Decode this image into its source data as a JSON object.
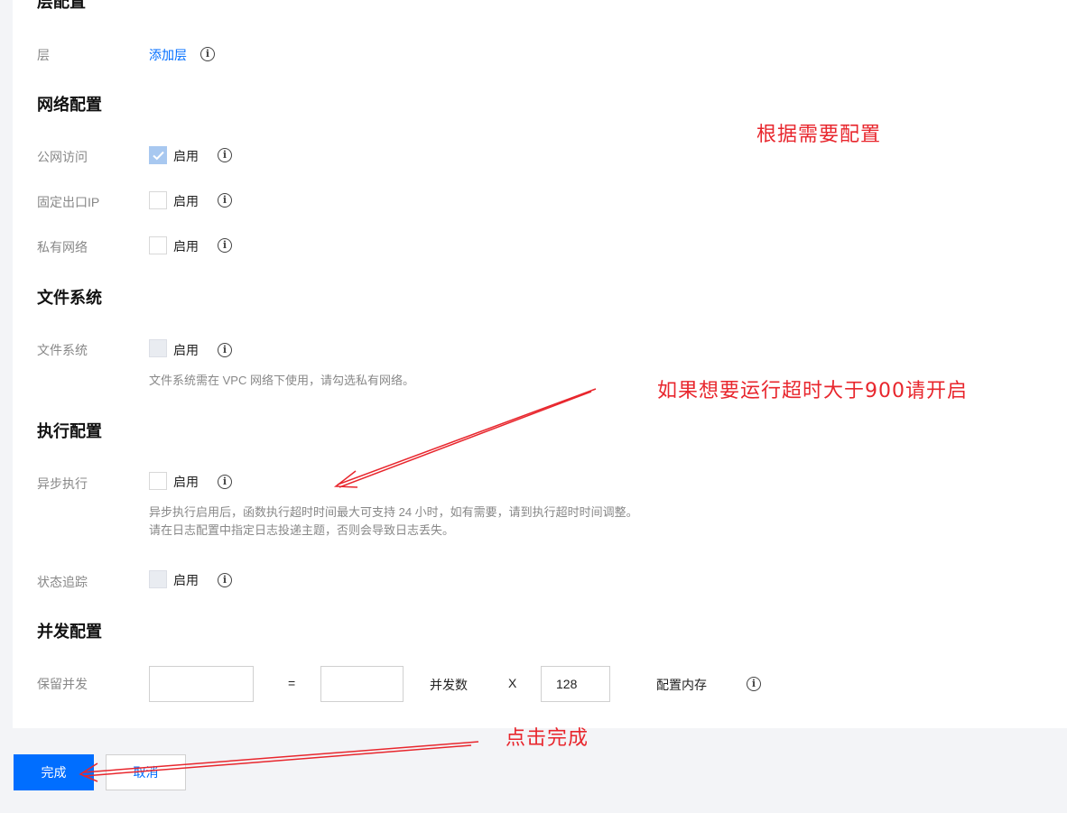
{
  "layer": {
    "section_title": "层配置",
    "label": "层",
    "add_link": "添加层"
  },
  "network": {
    "section_title": "网络配置",
    "public_access": {
      "label": "公网访问",
      "option": "启用",
      "checked": true
    },
    "fixed_ip": {
      "label": "固定出口IP",
      "option": "启用",
      "checked": false
    },
    "private_network": {
      "label": "私有网络",
      "option": "启用",
      "checked": false
    }
  },
  "filesystem": {
    "section_title": "文件系统",
    "label": "文件系统",
    "option": "启用",
    "hint": "文件系统需在 VPC 网络下使用，请勾选私有网络。"
  },
  "execution": {
    "section_title": "执行配置",
    "async": {
      "label": "异步执行",
      "option": "启用",
      "hint1": "异步执行启用后，函数执行超时时间最大可支持 24 小时，如有需要，请到执行超时时间调整。",
      "hint2": "请在日志配置中指定日志投递主题，否则会导致日志丢失。"
    },
    "tracking": {
      "label": "状态追踪",
      "option": "启用"
    }
  },
  "concurrency": {
    "section_title": "并发配置",
    "label": "保留并发",
    "input1_value": "",
    "equals": "=",
    "input2_value": "",
    "concurrency_label": "并发数",
    "times": "X",
    "memory_value": "128",
    "memory_label": "配置内存"
  },
  "footer": {
    "done": "完成",
    "cancel": "取消"
  },
  "annotations": {
    "configure_as_needed": "根据需要配置",
    "timeout_hint": "如果想要运行超时大于900请开启",
    "click_done": "点击完成"
  },
  "colors": {
    "primary": "#006eff",
    "annotation": "#e8262d",
    "background": "#f3f4f7"
  }
}
